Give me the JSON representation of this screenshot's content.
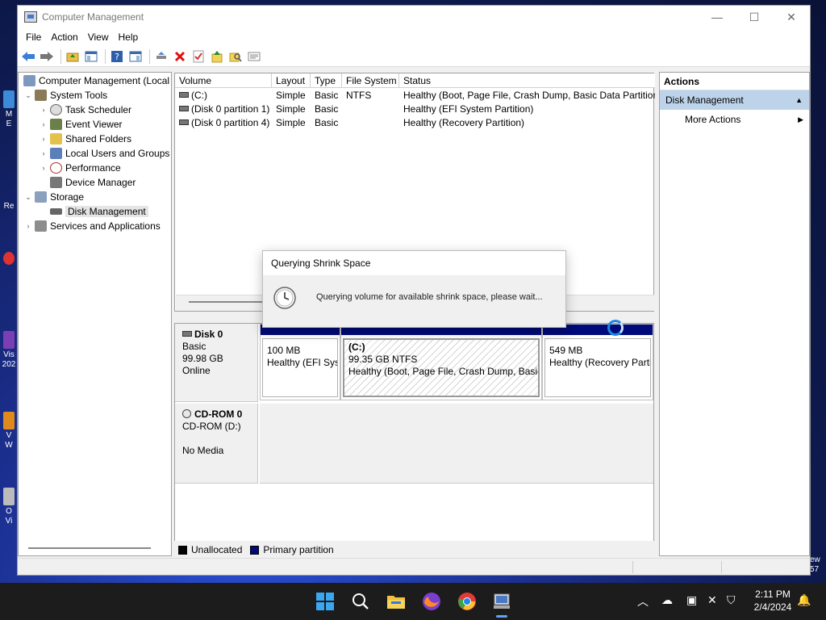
{
  "window": {
    "title": "Computer Management",
    "controls": {
      "minimize": "—",
      "maximize": "☐",
      "close": "✕"
    }
  },
  "menu": [
    "File",
    "Action",
    "View",
    "Help"
  ],
  "tree": {
    "items": [
      {
        "label": "Computer Management (Local",
        "icon": "computer-management-icon",
        "expander": ""
      },
      {
        "label": "System Tools",
        "icon": "tools-icon",
        "expander": "⌄"
      },
      {
        "label": "Task Scheduler",
        "icon": "clock-icon",
        "expander": "›"
      },
      {
        "label": "Event Viewer",
        "icon": "event-viewer-icon",
        "expander": "›"
      },
      {
        "label": "Shared Folders",
        "icon": "shared-folder-icon",
        "expander": "›"
      },
      {
        "label": "Local Users and Groups",
        "icon": "users-icon",
        "expander": "›"
      },
      {
        "label": "Performance",
        "icon": "performance-icon",
        "expander": "›"
      },
      {
        "label": "Device Manager",
        "icon": "device-manager-icon",
        "expander": ""
      },
      {
        "label": "Storage",
        "icon": "storage-icon",
        "expander": "⌄"
      },
      {
        "label": "Disk Management",
        "icon": "disk-management-icon",
        "expander": ""
      },
      {
        "label": "Services and Applications",
        "icon": "services-icon",
        "expander": "›"
      }
    ]
  },
  "volumes": {
    "columns": [
      "Volume",
      "Layout",
      "Type",
      "File System",
      "Status"
    ],
    "rows": [
      {
        "volume": "(C:)",
        "layout": "Simple",
        "type": "Basic",
        "fs": "NTFS",
        "status": "Healthy (Boot, Page File, Crash Dump, Basic Data Partition)"
      },
      {
        "volume": "(Disk 0 partition 1)",
        "layout": "Simple",
        "type": "Basic",
        "fs": "",
        "status": "Healthy (EFI System Partition)"
      },
      {
        "volume": "(Disk 0 partition 4)",
        "layout": "Simple",
        "type": "Basic",
        "fs": "",
        "status": "Healthy (Recovery Partition)"
      }
    ]
  },
  "disks": {
    "disk0": {
      "name": "Disk 0",
      "type": "Basic",
      "size": "99.98 GB",
      "state": "Online"
    },
    "partitions": [
      {
        "label": "",
        "size": "100 MB",
        "status": "Healthy (EFI Sys"
      },
      {
        "label": "(C:)",
        "size": "99.35 GB NTFS",
        "status": "Healthy (Boot, Page File, Crash Dump, Basic"
      },
      {
        "label": "",
        "size": "549 MB",
        "status": "Healthy (Recovery Parti"
      }
    ],
    "cdrom": {
      "name": "CD-ROM 0",
      "type": "CD-ROM (D:)",
      "state": "No Media"
    }
  },
  "legend": [
    {
      "label": "Unallocated",
      "color": "#000000"
    },
    {
      "label": "Primary partition",
      "color": "#000a78"
    }
  ],
  "actions": {
    "title": "Actions",
    "section": "Disk Management",
    "items": [
      "More Actions"
    ]
  },
  "dialog": {
    "title": "Querying Shrink Space",
    "message": "Querying volume for available shrink space, please wait..."
  },
  "taskbar": {
    "time": "2:11 PM",
    "date": "2/4/2024"
  },
  "colors": {
    "primary_partition": "#000a78",
    "selection": "#bcd3ea",
    "accent": "#1e88e5"
  }
}
